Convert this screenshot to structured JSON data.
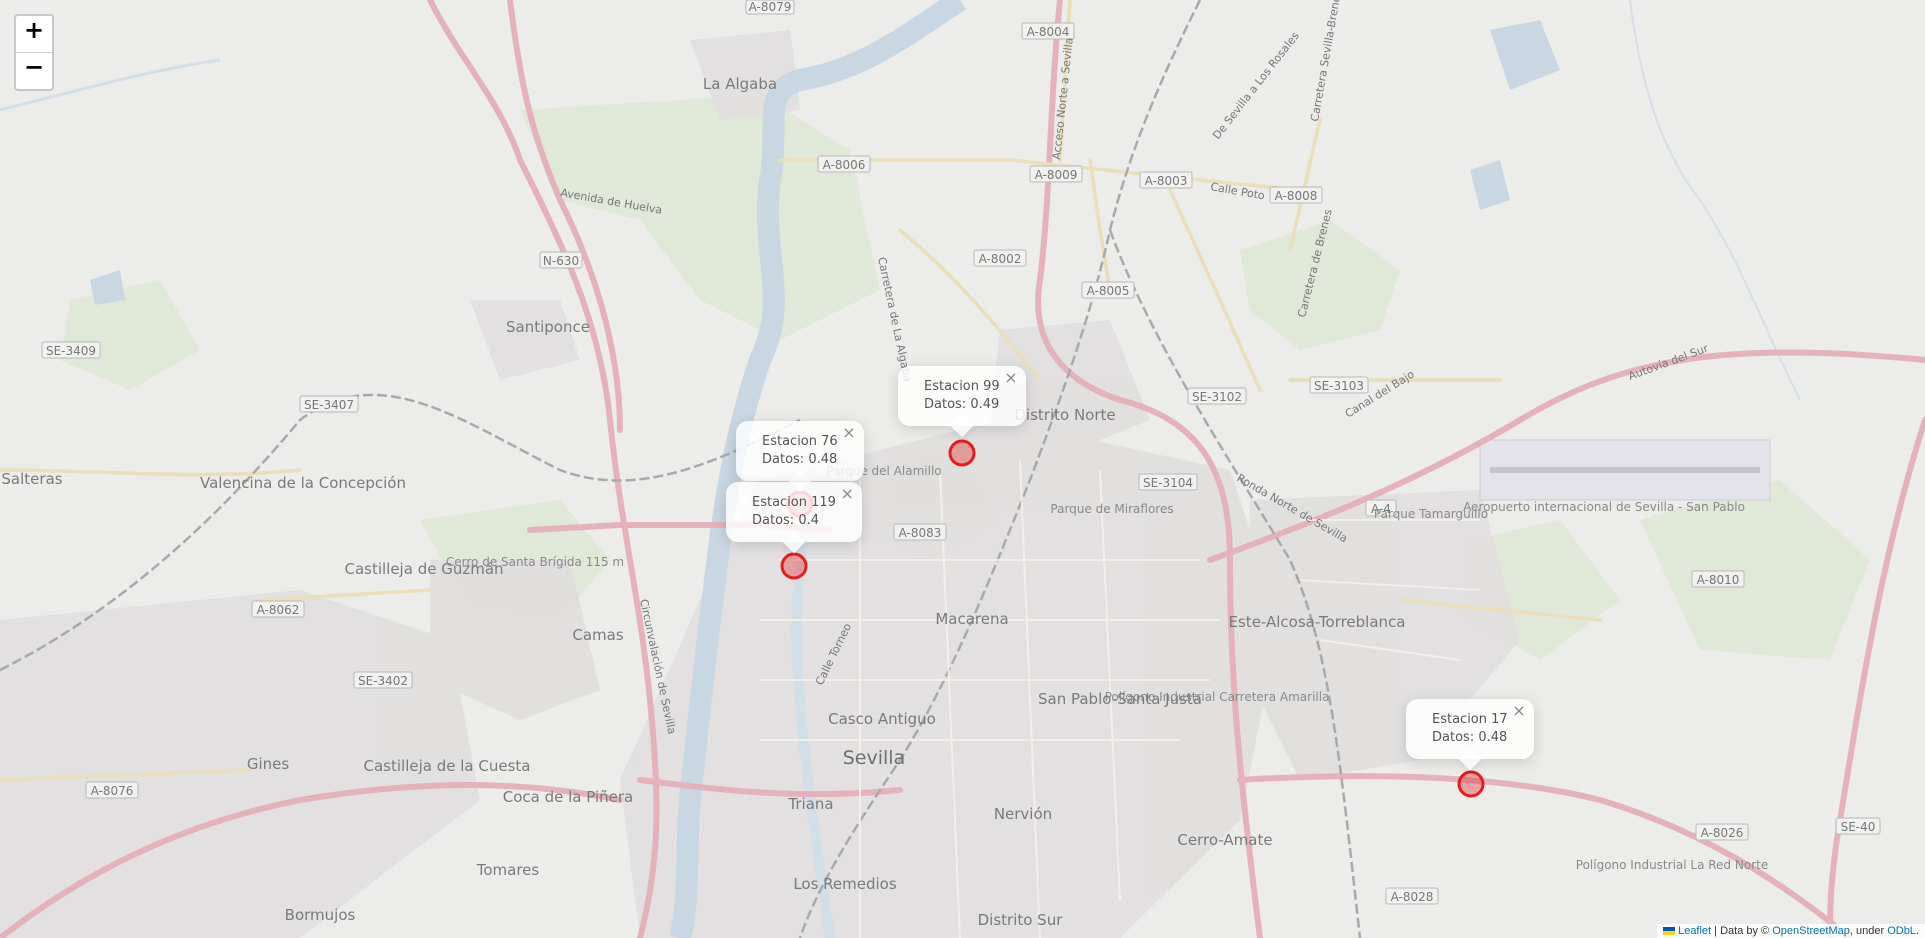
{
  "zoom": {
    "in_label": "+",
    "out_label": "−"
  },
  "places": [
    {
      "name": "La Algaba"
    },
    {
      "name": "Santiponce"
    },
    {
      "name": "Salteras"
    },
    {
      "name": "Valencina de la Concepción"
    },
    {
      "name": "Castilleja de Guzmán"
    },
    {
      "name": "Cerro de Santa Brígida 115 m"
    },
    {
      "name": "Camas"
    },
    {
      "name": "Gines"
    },
    {
      "name": "Castilleja de la Cuesta"
    },
    {
      "name": "Coca de la Piñera"
    },
    {
      "name": "Tomares"
    },
    {
      "name": "Bormujos"
    },
    {
      "name": "Triana"
    },
    {
      "name": "Los Remedios"
    },
    {
      "name": "Casco Antiguo"
    },
    {
      "name": "Sevilla"
    },
    {
      "name": "Macarena"
    },
    {
      "name": "Nervión"
    },
    {
      "name": "Distrito Sur"
    },
    {
      "name": "Distrito Norte"
    },
    {
      "name": "San Pablo-Santa Justa"
    },
    {
      "name": "Cerro-Amate"
    },
    {
      "name": "Este-Alcosa-Torreblanca"
    },
    {
      "name": "Parque de Miraflores"
    },
    {
      "name": "Parque Tamarguillo"
    },
    {
      "name": "Aeropuerto internacional de Sevilla - San Pablo"
    },
    {
      "name": "Polígono Industrial Carretera Amarilla"
    },
    {
      "name": "Polígono Industrial La Red Norte"
    },
    {
      "name": "Parque del Alamillo"
    }
  ],
  "road_tags": [
    "A-8079",
    "A-8004",
    "A-8006",
    "A-8009",
    "A-8003",
    "A-8008",
    "A-8002",
    "A-8005",
    "N-630",
    "SE-3409",
    "SE-3407",
    "SE-3102",
    "SE-3103",
    "SE-3104",
    "A-8083",
    "A-8062",
    "SE-3402",
    "A-8076",
    "A-8010",
    "A-8026",
    "SE-40",
    "A-8028",
    "A-4"
  ],
  "street_names": [
    "Carretera de La Algaba",
    "Acceso Norte a Sevilla",
    "De Sevilla a Los Rosales",
    "Carretera Sevilla-Brenes",
    "Calle Poto",
    "Carretera de Brenes",
    "Ronda Norte de Sevilla",
    "Autovía del Sur",
    "Canal del Bajo",
    "Circunvalación de Sevilla",
    "Calle Torneo",
    "Avenida de Huelva"
  ],
  "stations": [
    {
      "title": "Estacion 99",
      "data": "Datos: 0.49"
    },
    {
      "title": "Estacion 76",
      "data": "Datos: 0.48"
    },
    {
      "title": "Estacion 119",
      "data": "Datos: 0.4"
    },
    {
      "title": "Estacion 17",
      "data": "Datos: 0.48"
    }
  ],
  "popup_close": "×",
  "marker_color": "#e81c1c",
  "attribution": {
    "leaflet": "Leaflet",
    "mid": " | Data by © ",
    "osm": "OpenStreetMap",
    "under": ", under ",
    "odbl": "ODbL",
    "end": "."
  }
}
